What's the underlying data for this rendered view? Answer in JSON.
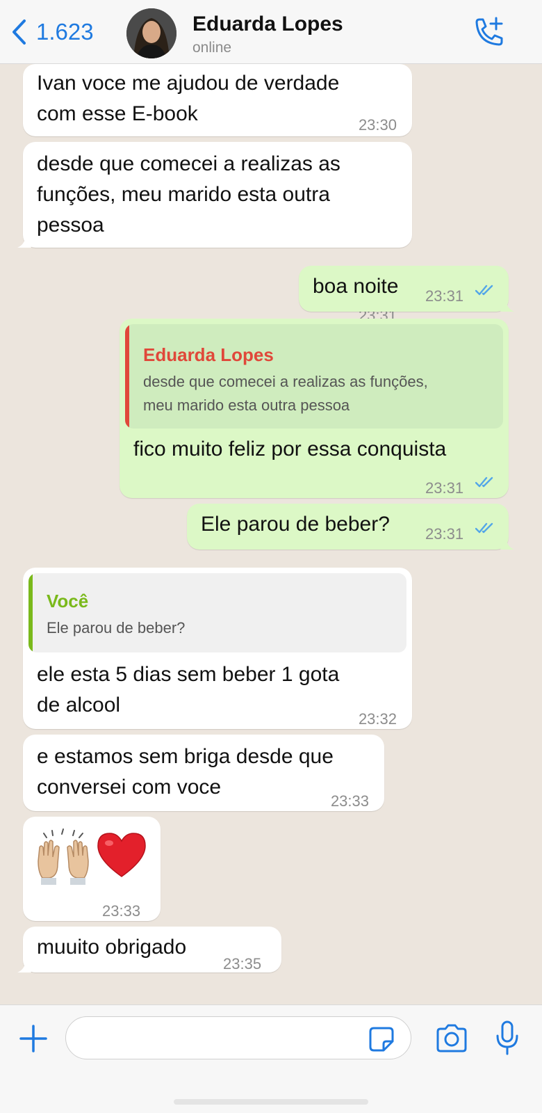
{
  "header": {
    "back_count": "1.623",
    "contact_name": "Eduarda Lopes",
    "status": "online"
  },
  "colors": {
    "accent_blue": "#1f7ae0",
    "incoming_bubble": "#ffffff",
    "outgoing_bubble": "#dcf8c6",
    "quote_red": "#e0483a",
    "quote_green": "#7ab91b",
    "read_ticks": "#53a6e8"
  },
  "messages": [
    {
      "dir": "in",
      "text": "Ivan voce me ajudou de verdade\ncom esse E-book",
      "time": "23:30"
    },
    {
      "dir": "in",
      "text": "desde que comecei a realizas as\nfunções, meu marido esta outra\npessoa",
      "time": "23:31"
    },
    {
      "dir": "out",
      "text": "boa noite",
      "time": "23:31",
      "read": true
    },
    {
      "dir": "out",
      "quote_name": "Eduarda Lopes",
      "quote_text": "desde que comecei a realizas as funções,\nmeu marido esta outra pessoa",
      "text": "fico muito feliz por essa conquista",
      "time": "23:31",
      "read": true
    },
    {
      "dir": "out",
      "text": "Ele parou de beber?",
      "time": "23:31",
      "read": true
    },
    {
      "dir": "in",
      "quote_name": "Você",
      "quote_text": "Ele parou de beber?",
      "text": "ele esta 5 dias sem beber 1 gota\nde alcool",
      "time": "23:32"
    },
    {
      "dir": "in",
      "text": "e estamos sem briga desde que\nconversei com voce",
      "time": "23:33"
    },
    {
      "dir": "in",
      "emoji": "raising-hands and red-heart",
      "time": "23:33"
    },
    {
      "dir": "in",
      "text": "muuito obrigado",
      "time": "23:35"
    }
  ],
  "input": {
    "placeholder": ""
  },
  "icons": [
    "chevron-left-icon",
    "call-add-icon",
    "plus-icon",
    "sticker-icon",
    "camera-icon",
    "microphone-icon",
    "double-check-icon"
  ]
}
